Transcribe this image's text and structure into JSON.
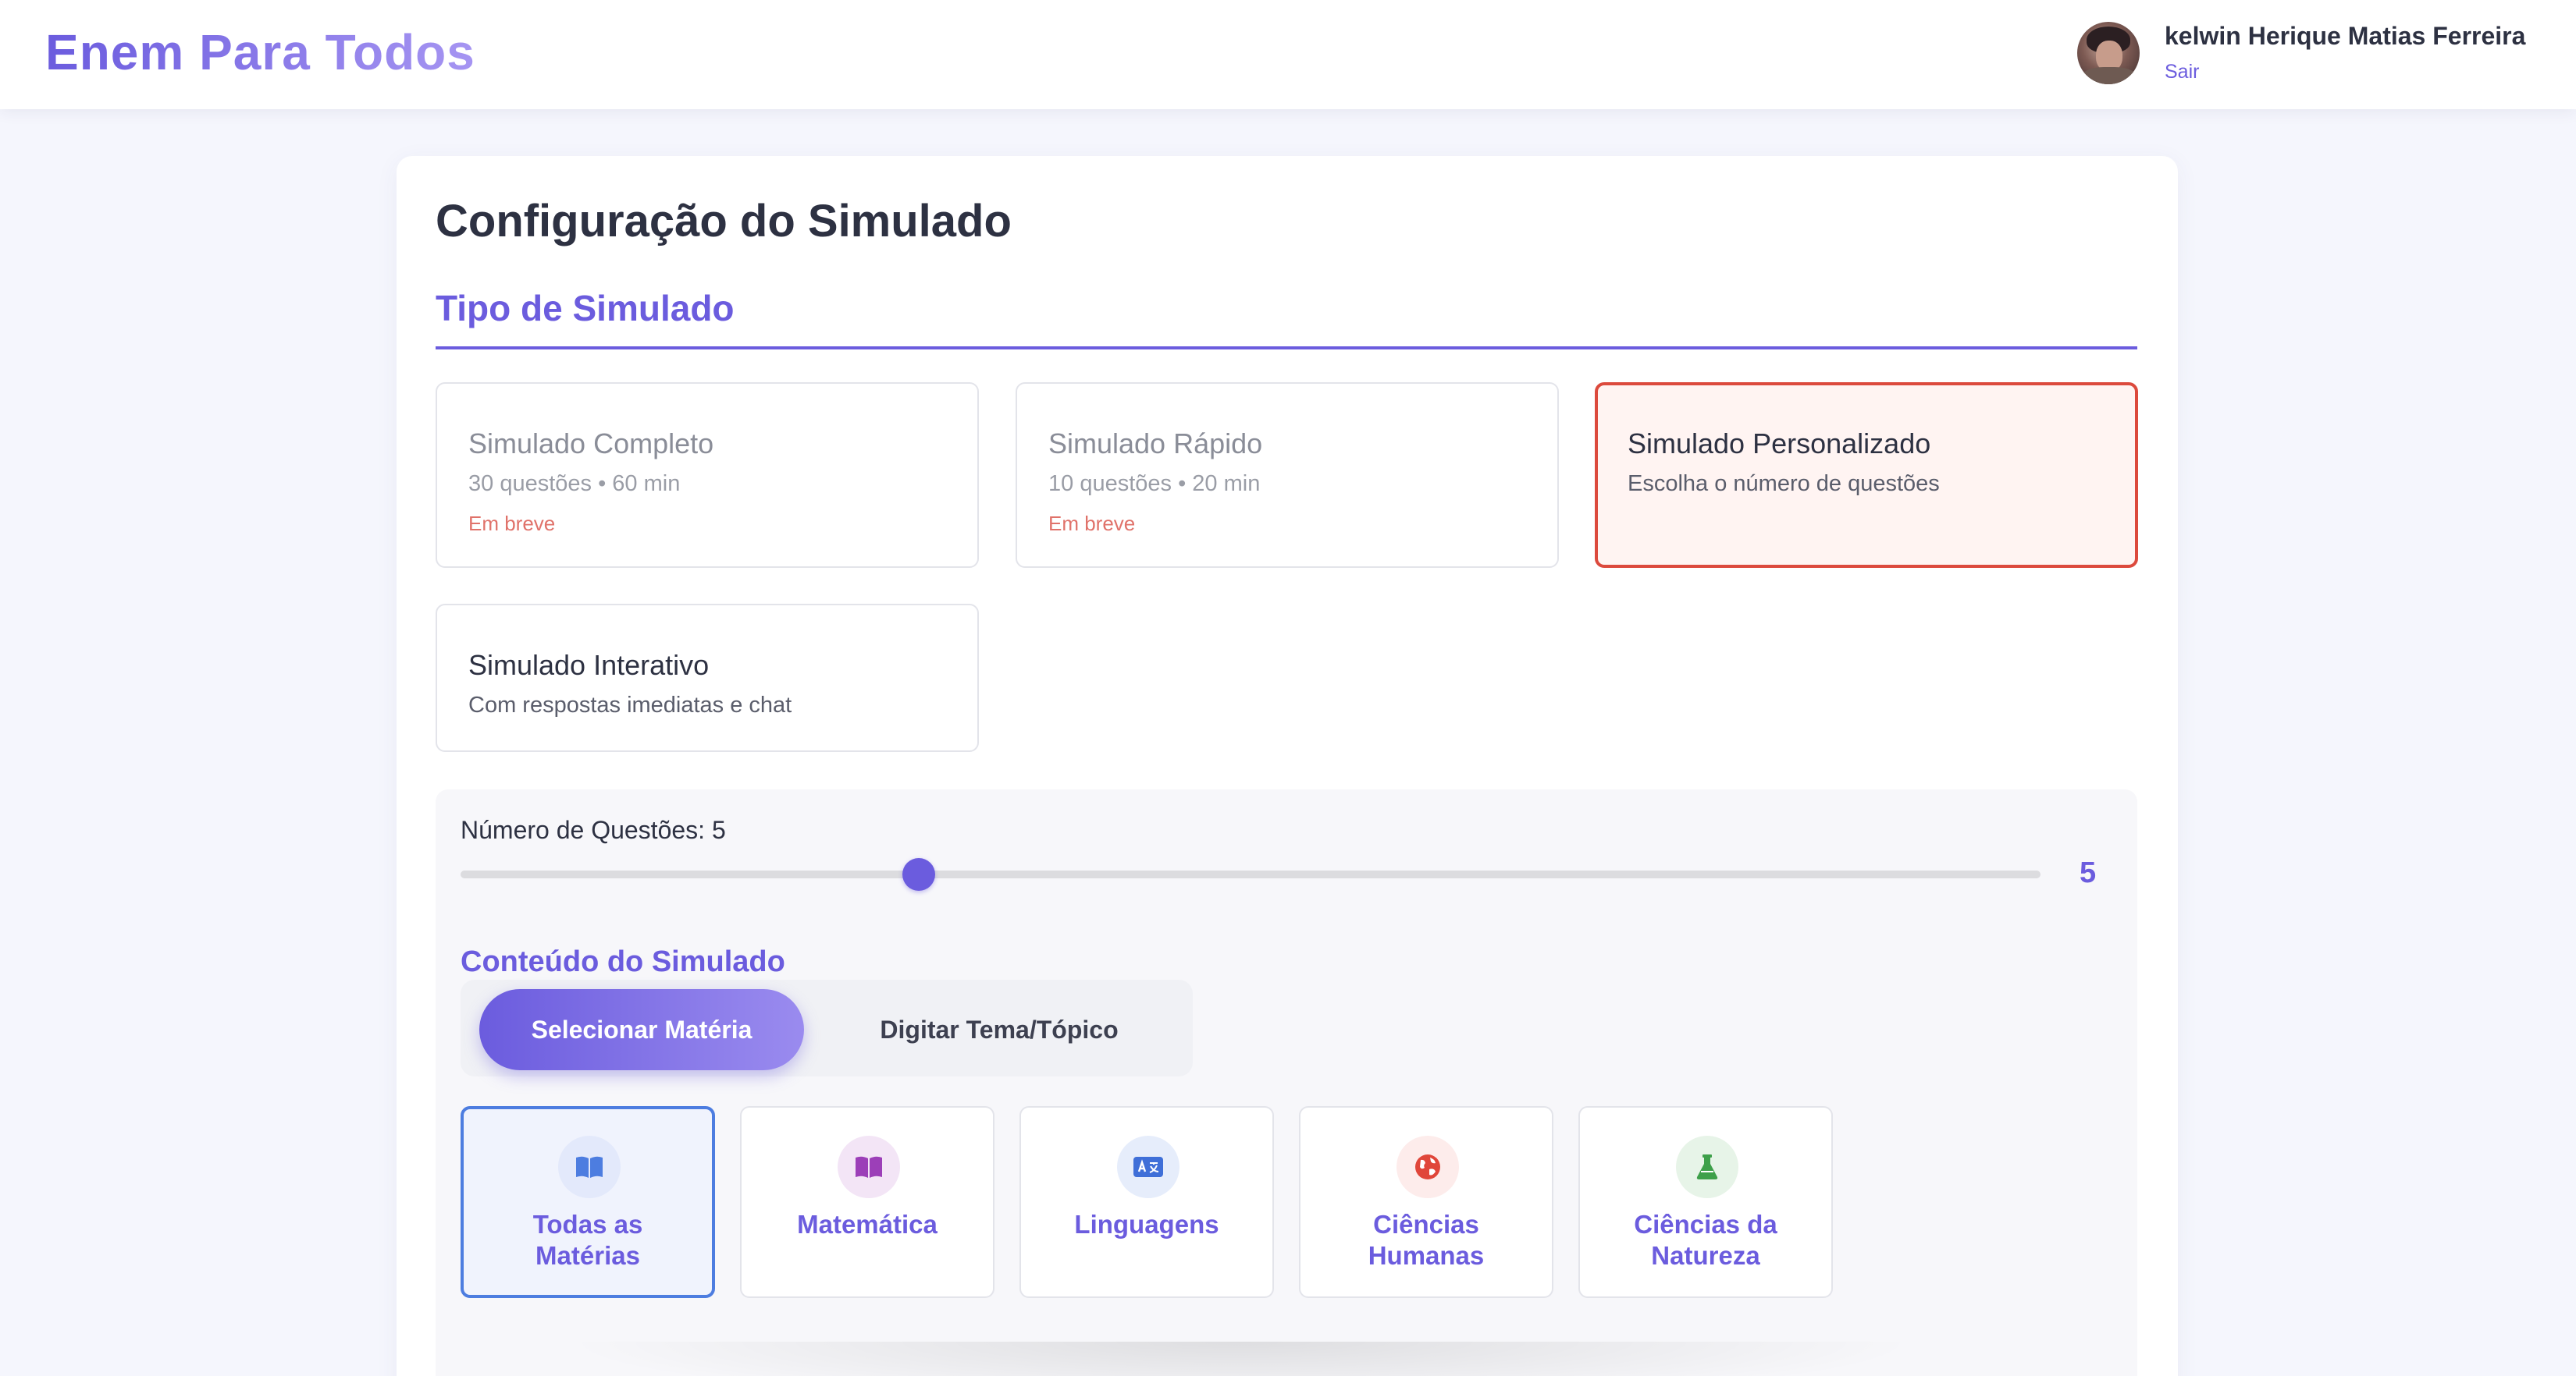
{
  "header": {
    "brand": "Enem Para Todos",
    "user_name": "kelwin Herique Matias Ferreira",
    "logout_label": "Sair"
  },
  "page": {
    "title": "Configuração do Simulado",
    "section_title": "Tipo de Simulado"
  },
  "simulation_types": [
    {
      "name": "Simulado Completo",
      "description": "30 questões • 60 min",
      "status": "Em breve",
      "state": "disabled"
    },
    {
      "name": "Simulado Rápido",
      "description": "10 questões • 20 min",
      "status": "Em breve",
      "state": "disabled"
    },
    {
      "name": "Simulado Personalizado",
      "description": "Escolha o número de questões",
      "state": "selected"
    },
    {
      "name": "Simulado Interativo",
      "description": "Com respostas imediatas e chat",
      "state": "default"
    }
  ],
  "questions": {
    "label": "Número de Questões: 5",
    "value": "5",
    "value_number": 5,
    "fraction": 0.29
  },
  "content": {
    "title": "Conteúdo do Simulado",
    "modes": [
      {
        "label": "Selecionar Matéria",
        "active": true
      },
      {
        "label": "Digitar Tema/Tópico",
        "active": false
      }
    ],
    "subjects": [
      {
        "label": "Todas as Matérias",
        "icon": "book-open-icon",
        "icon_color": "#4d7de0",
        "icon_bg": "#e3e9fb",
        "active": true
      },
      {
        "label": "Matemática",
        "icon": "book-open-icon",
        "icon_color": "#9c3fb8",
        "icon_bg": "#f3e5f6",
        "active": false
      },
      {
        "label": "Linguagens",
        "icon": "language-icon",
        "icon_color": "#3f6fd8",
        "icon_bg": "#e6edfb",
        "active": false
      },
      {
        "label": "Ciências Humanas",
        "icon": "globe-icon",
        "icon_color": "#e0463a",
        "icon_bg": "#fdeceb",
        "active": false
      },
      {
        "label": "Ciências da Natureza",
        "icon": "flask-icon",
        "icon_color": "#3ea04a",
        "icon_bg": "#e7f4e8",
        "active": false
      }
    ]
  },
  "colors": {
    "accent": "#6b5cde",
    "selected_border": "#dc4a3d",
    "soon_text": "#e0726a"
  }
}
